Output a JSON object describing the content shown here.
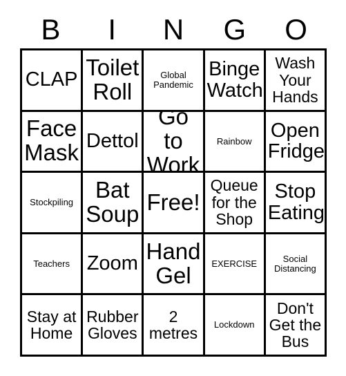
{
  "card": {
    "title": "BINGO",
    "header_letters": [
      "B",
      "I",
      "N",
      "G",
      "O"
    ],
    "grid_size": "5x5",
    "free_space": "Free!",
    "colors": {
      "background": "#ffffff",
      "border": "#000000",
      "text": "#000000"
    },
    "rows": [
      {
        "cells": [
          {
            "label": "CLAP",
            "size": "lg"
          },
          {
            "label": "Toilet Roll",
            "size": "xl"
          },
          {
            "label": "Global Pandemic",
            "size": "sm"
          },
          {
            "label": "Binge Watch",
            "size": "lg"
          },
          {
            "label": "Wash Your Hands",
            "size": "md"
          }
        ]
      },
      {
        "cells": [
          {
            "label": "Face Mask",
            "size": "xl"
          },
          {
            "label": "Dettol",
            "size": "lg"
          },
          {
            "label": "Go to Work",
            "size": "xl"
          },
          {
            "label": "Rainbow",
            "size": "sm"
          },
          {
            "label": "Open Fridge",
            "size": "lg"
          }
        ]
      },
      {
        "cells": [
          {
            "label": "Stockpiling",
            "size": "sm"
          },
          {
            "label": "Bat Soup",
            "size": "xl"
          },
          {
            "label": "Free!",
            "size": "xl"
          },
          {
            "label": "Queue for the Shop",
            "size": "md"
          },
          {
            "label": "Stop Eating",
            "size": "lg"
          }
        ]
      },
      {
        "cells": [
          {
            "label": "Teachers",
            "size": "sm"
          },
          {
            "label": "Zoom",
            "size": "lg"
          },
          {
            "label": "Hand Gel",
            "size": "xl"
          },
          {
            "label": "EXERCISE",
            "size": "sm"
          },
          {
            "label": "Social Distancing",
            "size": "sm"
          }
        ]
      },
      {
        "cells": [
          {
            "label": "Stay at Home",
            "size": "md"
          },
          {
            "label": "Rubber Gloves",
            "size": "md"
          },
          {
            "label": "2 metres",
            "size": "md"
          },
          {
            "label": "Lockdown",
            "size": "sm"
          },
          {
            "label": "Don't Get the Bus",
            "size": "md"
          }
        ]
      }
    ]
  }
}
